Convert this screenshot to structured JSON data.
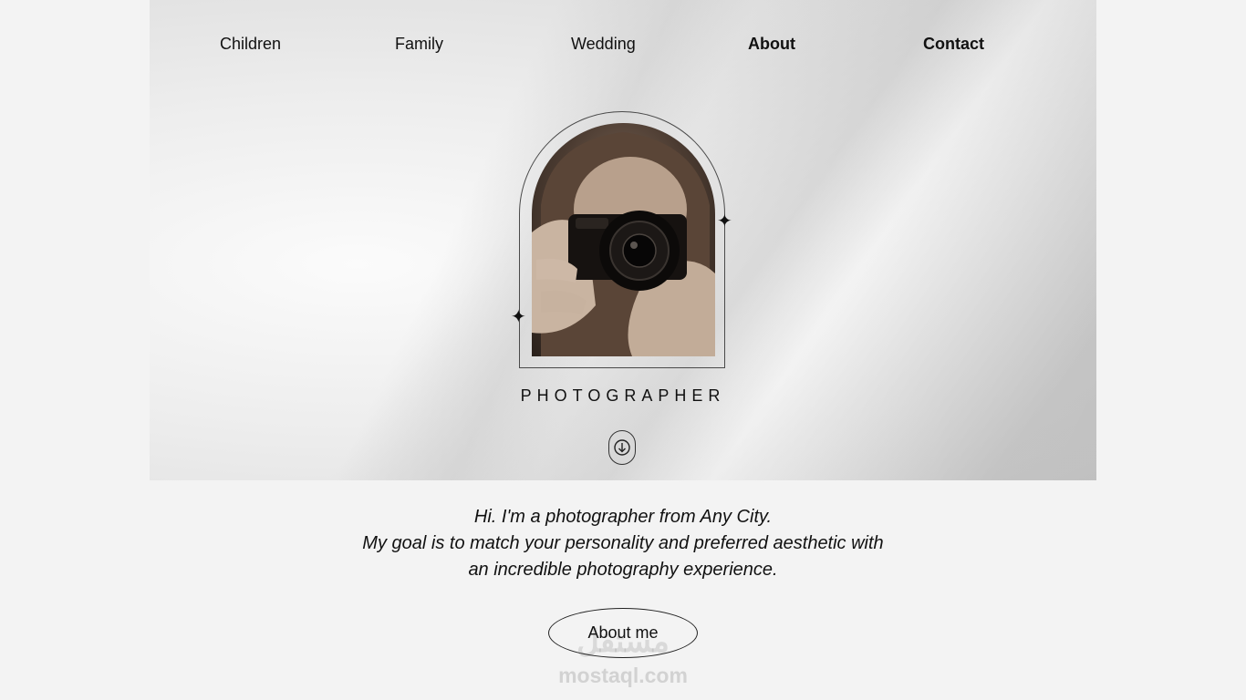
{
  "nav": {
    "items": [
      {
        "label": "Children"
      },
      {
        "label": "Family"
      },
      {
        "label": "Wedding"
      },
      {
        "label": "About"
      },
      {
        "label": "Contact"
      }
    ]
  },
  "hero": {
    "title": "PHOTOGRAPHER",
    "photo_icon": "photographer-with-camera-image",
    "sparkle_glyph": "✦",
    "scroll_icon": "arrow-down-icon"
  },
  "intro": {
    "lines": [
      "Hi. I'm a photographer from Any City.",
      "My goal is to match your personality and preferred aesthetic with",
      "an incredible photography experience."
    ]
  },
  "cta": {
    "about_label": "About me"
  },
  "watermark": {
    "arabic": "مستقل",
    "text": "mostaql.com"
  },
  "colors": {
    "page_bg": "#f3f3f3",
    "text": "#111111",
    "photo_tone": "#4b3b31"
  }
}
